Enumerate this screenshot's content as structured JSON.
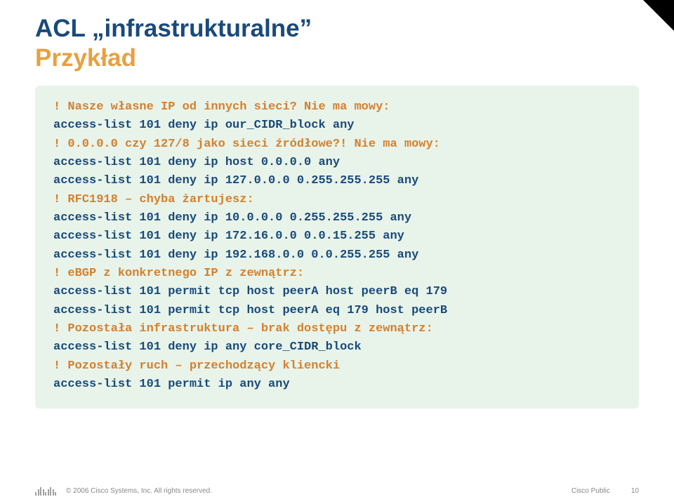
{
  "title": {
    "main": "ACL „infrastrukturalne”",
    "sub": "Przykład"
  },
  "code": {
    "c1": "! Nasze własne IP od innych sieci? Nie ma mowy:",
    "l1": "access-list 101 deny ip our_CIDR_block any",
    "c2": "! 0.0.0.0 czy 127/8 jako sieci źródłowe?! Nie ma mowy:",
    "l2": "access-list 101 deny ip host 0.0.0.0 any",
    "l3": "access-list 101 deny ip 127.0.0.0 0.255.255.255 any",
    "c3": "! RFC1918 – chyba żartujesz:",
    "l4": "access-list 101 deny ip 10.0.0.0 0.255.255.255 any",
    "l5": "access-list 101 deny ip 172.16.0.0 0.0.15.255 any",
    "l6": "access-list 101 deny ip 192.168.0.0 0.0.255.255 any",
    "c4": "! eBGP z konkretnego IP z zewnątrz:",
    "l7": "access-list 101 permit tcp host peerA host peerB eq 179",
    "l8": "access-list 101 permit tcp host peerA eq 179 host peerB",
    "c5": "! Pozostała infrastruktura – brak dostępu z zewnątrz:",
    "l9": "access-list 101 deny ip any core_CIDR_block",
    "c6": "! Pozostały ruch – przechodzący kliencki",
    "l10": "access-list 101 permit ip any any"
  },
  "footer": {
    "copyright": "© 2006 Cisco Systems, Inc. All rights reserved.",
    "label": "Cisco Public",
    "page": "10"
  }
}
